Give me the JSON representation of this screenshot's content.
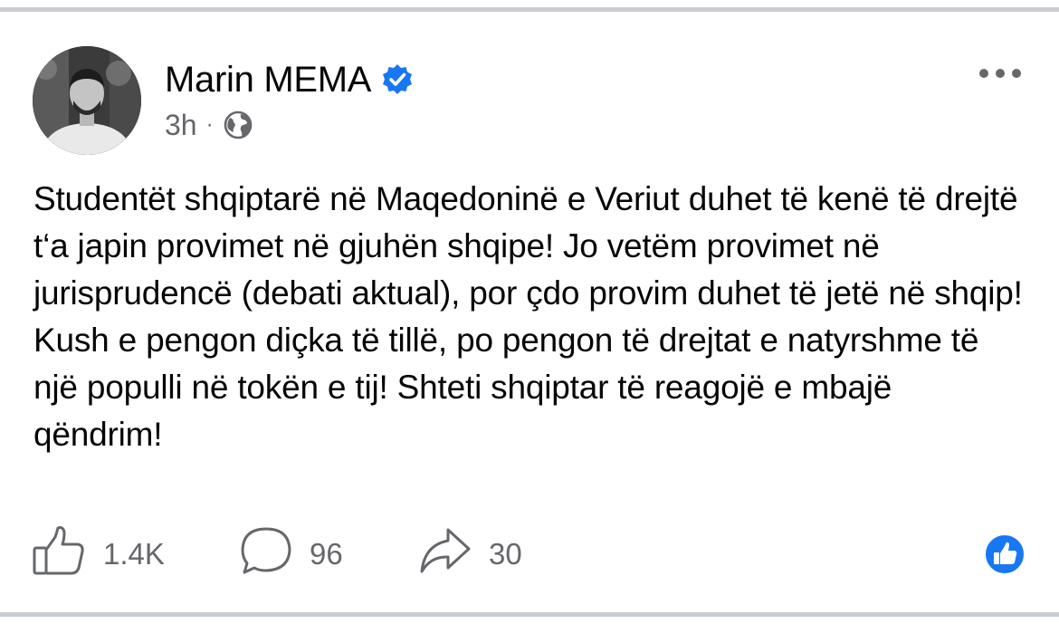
{
  "post": {
    "author": "Marin MEMA",
    "time": "3h",
    "separator": "·",
    "text": "Studentët shqiptarë në Maqedoninë e Veriut duhet të kenë të drejtë t‘a japin provimet në gjuhën shqipe! Jo vetëm provimet në jurisprudencë (debati aktual), por çdo provim duhet të jetë në shqip! Kush e pengon diçka të tillë, po pengon të drejtat e natyrshme të një populli në tokën e tij! Shteti shqiptar të reagojë e mbajë qëndrim!"
  },
  "actions": {
    "likes": "1.4K",
    "comments": "96",
    "shares": "30"
  },
  "icons": {
    "verified": "verified-badge-icon",
    "audience": "globe-icon",
    "more": "more-options-icon",
    "like": "thumbs-up-icon",
    "comment": "comment-bubble-icon",
    "share": "share-arrow-icon",
    "reaction": "like-reaction-icon"
  },
  "colors": {
    "accent": "#1877f2",
    "secondary_text": "#65676b",
    "divider": "#c9ccd1"
  }
}
